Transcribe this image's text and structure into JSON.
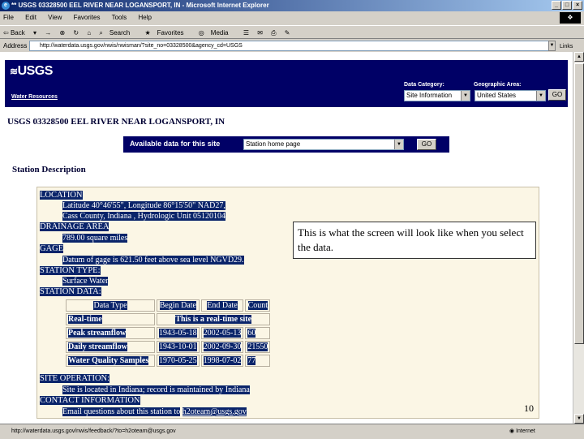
{
  "window": {
    "title": "** USGS 03328500 EEL RIVER NEAR LOGANSPORT, IN - Microsoft Internet Explorer"
  },
  "menu": [
    "File",
    "Edit",
    "View",
    "Favorites",
    "Tools",
    "Help"
  ],
  "toolbar": {
    "back": "Back",
    "forward": "→",
    "stop": "⊗",
    "refresh": "↻",
    "home": "⌂",
    "search": "Search",
    "favorites": "Favorites",
    "media": "Media",
    "history": "☰",
    "mail": "✉",
    "print": "⎙",
    "edit": "✎"
  },
  "address": {
    "label": "Address",
    "url": "http://waterdata.usgs.gov/nwis/nwisman/?site_no=03328500&agency_cd=USGS",
    "go": "Go",
    "links": "Links"
  },
  "usgs": {
    "logo": "USGS",
    "water_resources": "Water Resources",
    "data_category_label": "Data Category:",
    "data_category_value": "Site Information",
    "geo_area_label": "Geographic Area:",
    "geo_area_value": "United States",
    "go": "GO"
  },
  "site_title": "USGS 03328500 EEL RIVER NEAR LOGANSPORT, IN",
  "available": {
    "label": "Available data for this site",
    "value": "Station home page",
    "go": "GO"
  },
  "station_description": "Station Description",
  "desc": {
    "location": "LOCATION",
    "loc1": "Latitude 40°46'55\", Longitude 86°15'50\" NAD27,",
    "loc2": "Cass County, Indiana , Hydrologic Unit 05120104",
    "drainage": "DRAINAGE AREA",
    "drainage_val": "789.00 square miles",
    "gage": "GAGE",
    "gage_val": "Datum of gage is 621.50 feet above sea level NGVD29.",
    "station_type": "STATION TYPE:",
    "station_type_val": "Surface Water",
    "station_data": "STATION DATA:",
    "table_headers": [
      "Data Type",
      "Begin Date",
      "End Date",
      "Count"
    ],
    "realtime_label": "Real-time",
    "realtime_text": "This is a real-time site",
    "rows": [
      [
        "Peak streamflow",
        "1943-05-18",
        "2002-05-13",
        "60"
      ],
      [
        "Daily streamflow",
        "1943-10-01",
        "2002-09-30",
        "21550"
      ],
      [
        "Water Quality Samples",
        "1970-05-25",
        "1998-07-02",
        "77"
      ]
    ],
    "site_op": "SITE OPERATION:",
    "site_op_val": "Site is located in Indiana; record is maintained by Indiana",
    "contact": "CONTACT INFORMATION",
    "contact_val": "Email questions about this station to",
    "contact_email": "h2oteam@usgs.gov"
  },
  "callout": "This is what the screen will look like when you select the data.",
  "slide_number": "10",
  "status": {
    "url": "http://waterdata.usgs.gov/nwis/feedback/?to=h2oteam@usgs.gov",
    "zone": "Internet"
  }
}
